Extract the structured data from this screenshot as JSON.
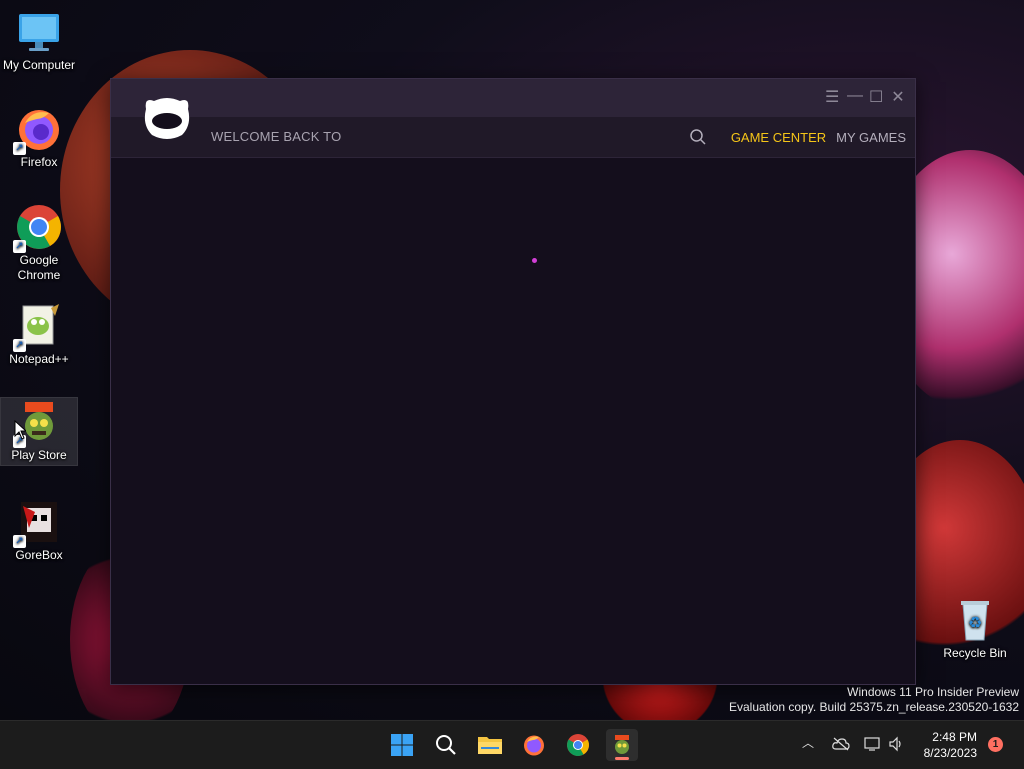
{
  "desktop": {
    "icons": [
      {
        "label": "My Computer",
        "icon": "monitor-icon"
      },
      {
        "label": "Firefox",
        "icon": "firefox-icon"
      },
      {
        "label": "Google Chrome",
        "icon": "chrome-icon"
      },
      {
        "label": "Notepad++",
        "icon": "notepad-plus-plus-icon"
      },
      {
        "label": "Play Store",
        "icon": "games-store-icon"
      },
      {
        "label": "GoreBox",
        "icon": "gorebox-icon"
      },
      {
        "label": "Recycle Bin",
        "icon": "recycle-bin-icon"
      }
    ]
  },
  "app": {
    "controls": {
      "menu": "☰",
      "minimize": "—",
      "maximize": "☐",
      "close": "✕"
    },
    "header": {
      "welcome": "WELCOME BACK TO",
      "nav_active": "GAME CENTER",
      "nav_inactive": "MY GAMES"
    },
    "colors": {
      "accent": "#f5c518",
      "loader": "#d23fd6"
    }
  },
  "watermark": {
    "line1": "Windows 11 Pro Insider Preview",
    "line2": "Evaluation copy. Build 25375.zn_release.230520-1632"
  },
  "taskbar": {
    "items": [
      "start-icon",
      "search-icon",
      "file-explorer-icon",
      "firefox-icon",
      "chrome-icon",
      "games-store-icon"
    ],
    "clock": {
      "time": "2:48 PM",
      "date": "8/23/2023"
    },
    "notification_count": "1"
  }
}
